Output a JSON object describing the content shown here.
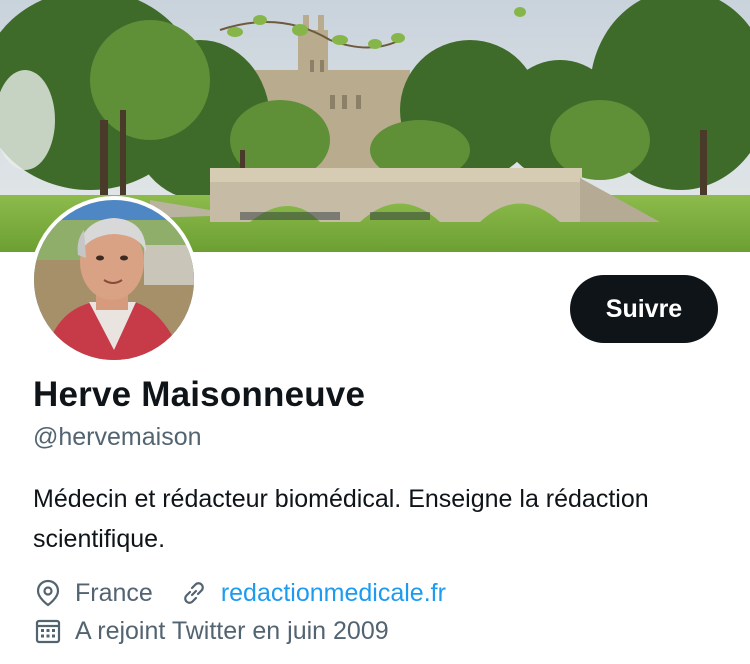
{
  "profile": {
    "name": "Herve Maisonneuve",
    "handle": "@hervemaison",
    "bio": "Médecin et rédacteur biomédical. Enseigne la rédaction scientifique.",
    "location": "France",
    "website": "redactionmedicale.fr",
    "joined": "A rejoint Twitter en juin 2009"
  },
  "actions": {
    "follow_label": "Suivre"
  },
  "icons": {
    "location": "location-pin-icon",
    "website": "link-icon",
    "joined": "calendar-icon"
  },
  "colors": {
    "accent": "#1d9bf0",
    "secondary_text": "#536471",
    "button_bg": "#0f1419"
  }
}
